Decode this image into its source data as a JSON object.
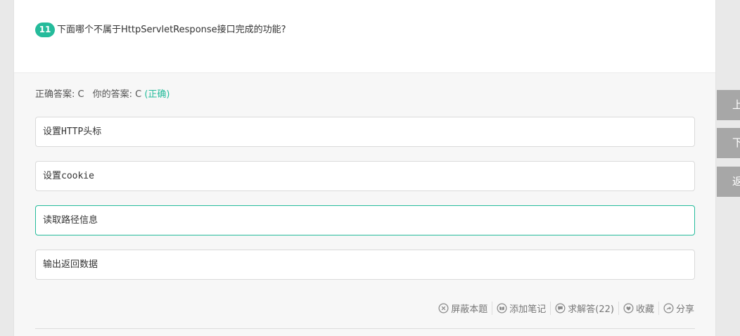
{
  "question": {
    "number": "11",
    "text": "下面哪个不属于HttpServletResponse接口完成的功能?"
  },
  "answer": {
    "correct_label": "正确答案: C",
    "yours_label": "你的答案: C",
    "status": "(正确)"
  },
  "options": [
    {
      "text": "设置HTTP头标"
    },
    {
      "text": "设置cookie"
    },
    {
      "text": "读取路径信息"
    },
    {
      "text": "输出返回数据"
    }
  ],
  "actions": {
    "block": "屏蔽本题",
    "note": "添加笔记",
    "ask": "求解答(22)",
    "fav": "收藏",
    "share": "分享"
  },
  "side_nav": {
    "prev": "上",
    "next": "下",
    "back": "返"
  },
  "colors": {
    "accent": "#25bb9b",
    "side_button": "#a7a7a7"
  }
}
